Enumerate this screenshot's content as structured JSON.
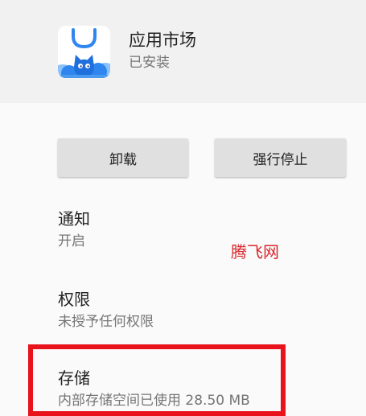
{
  "app": {
    "name": "应用市场",
    "status": "已安装",
    "icon": "app-market-icon"
  },
  "actions": {
    "uninstall_label": "卸载",
    "force_stop_label": "强行停止"
  },
  "settings": [
    {
      "title": "通知",
      "subtitle": "开启"
    },
    {
      "title": "权限",
      "subtitle": "未授予任何权限"
    },
    {
      "title": "存储",
      "subtitle": "内部存储空间已使用 28.50 MB"
    }
  ],
  "watermark": "腾飞网",
  "colors": {
    "header_bg": "#f1f1f1",
    "body_bg": "#fafafa",
    "button_bg": "#e0e0e0",
    "primary_text": "#212121",
    "secondary_text": "#757575",
    "highlight_border": "#e8131b",
    "watermark": "#d9262c",
    "icon_blue": "#2f86ee"
  }
}
